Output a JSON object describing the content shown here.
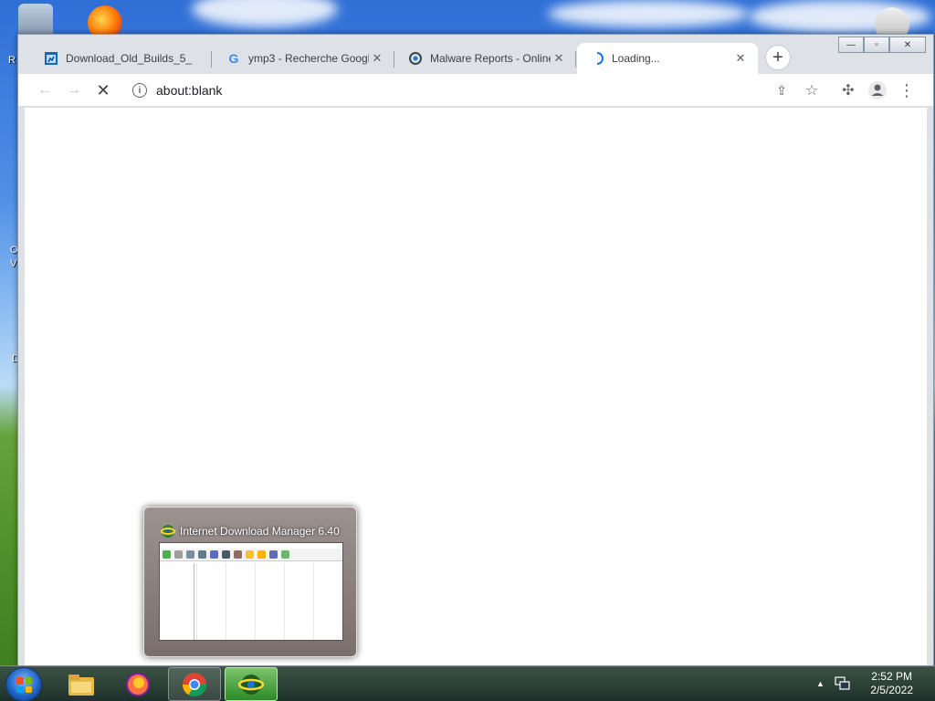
{
  "browser": {
    "tabs": [
      {
        "title": "Download_Old_Builds_5_",
        "icon": "spreadsheet-icon"
      },
      {
        "title": "ymp3 - Recherche Googl",
        "icon": "google-g-icon"
      },
      {
        "title": "Malware Reports - Online",
        "icon": "malware-reports-icon"
      },
      {
        "title": "Loading...",
        "icon": "loading-spinner-icon",
        "active": true
      }
    ],
    "new_tab_label": "+",
    "tab_close_glyph": "✕",
    "address": "about:blank",
    "info_glyph": "i",
    "window_controls": {
      "minimize": "—",
      "maximize": "▫",
      "close": "✕"
    }
  },
  "toolbar_icons": {
    "back": "←",
    "forward": "→",
    "stop": "✕",
    "share": "⇪",
    "bookmark": "☆",
    "extensions": "✣",
    "profile": "●",
    "menu": "⋮"
  },
  "thumbnail": {
    "title": "Internet Download Manager 6.40"
  },
  "taskbar": {
    "items": [
      "file-explorer-icon",
      "firefox-icon",
      "chrome-icon",
      "idm-icon"
    ],
    "tray_arrow": "▲",
    "time": "2:52 PM",
    "date": "2/5/2022"
  },
  "desktop": {
    "labels": [
      "R",
      "O",
      "V",
      "D"
    ]
  },
  "colors": {
    "chrome_frame": "#dee1e6",
    "accent_blue": "#1a73e8",
    "idm_green": "#2e8a28"
  }
}
